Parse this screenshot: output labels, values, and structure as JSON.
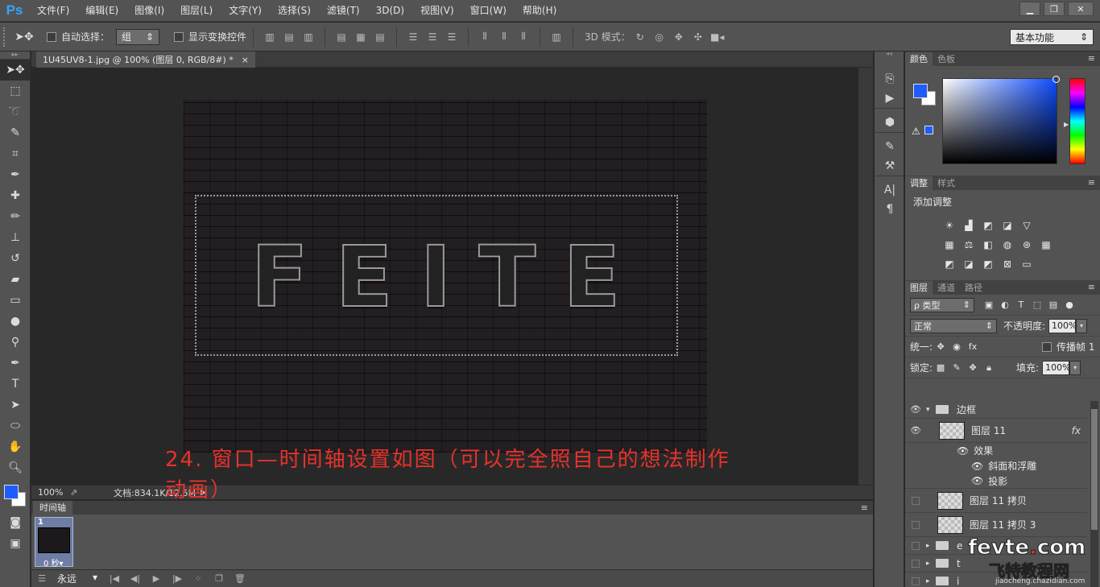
{
  "app": {
    "logo": "Ps"
  },
  "menu": [
    "文件(F)",
    "编辑(E)",
    "图像(I)",
    "图层(L)",
    "文字(Y)",
    "选择(S)",
    "滤镜(T)",
    "3D(D)",
    "视图(V)",
    "窗口(W)",
    "帮助(H)"
  ],
  "window_controls": {
    "minimize": "▁",
    "restore": "❐",
    "close": "✕"
  },
  "options": {
    "auto_select_label": "自动选择：",
    "auto_select_value": "组",
    "show_transform_label": "显示变换控件",
    "mode3d_label": "3D 模式：",
    "workspace": "基本功能"
  },
  "document": {
    "tab_title": "1U45UV8-1.jpg @ 100% (图层 0, RGB/8#) *",
    "close": "×",
    "art_text": "FEITE"
  },
  "status": {
    "zoom": "100%",
    "doc_info": "文档:834.1K/12.5M"
  },
  "timeline": {
    "tab": "时间轴",
    "frame_number": "1",
    "frame_delay": "0 秒▾",
    "loop": "永远"
  },
  "annotation": "24. 窗口—时间轴设置如图（可以完全照自己的想法制作动画）",
  "color_panel": {
    "tabs": [
      "颜色",
      "色板"
    ]
  },
  "adjust_panel": {
    "tabs": [
      "调整",
      "样式"
    ],
    "title": "添加调整"
  },
  "layers_panel": {
    "tabs": [
      "图层",
      "通道",
      "路径"
    ],
    "filter": "ρ 类型",
    "blend_mode": "正常",
    "opacity_label": "不透明度:",
    "opacity_value": "100%",
    "unify_label": "统一:",
    "propagate_label": "传播帧 1",
    "lock_label": "锁定:",
    "fill_label": "填充:",
    "fill_value": "100%",
    "layers": [
      {
        "name": "边框",
        "kind": "group",
        "visible": true,
        "expanded": true
      },
      {
        "name": "图层 11",
        "kind": "layer",
        "visible": true,
        "fx": "fx"
      },
      {
        "name": "效果",
        "kind": "effects"
      },
      {
        "name": "斜面和浮雕",
        "kind": "effect"
      },
      {
        "name": "投影",
        "kind": "effect"
      },
      {
        "name": "图层 11 拷贝",
        "kind": "layer",
        "visible": false
      },
      {
        "name": "图层 11 拷贝 3",
        "kind": "layer",
        "visible": false
      },
      {
        "name": "e",
        "kind": "group",
        "visible": false
      },
      {
        "name": "t",
        "kind": "group",
        "visible": false
      },
      {
        "name": "i",
        "kind": "group",
        "visible": false
      }
    ]
  },
  "watermark": {
    "main_a": "fevte",
    "main_dot": ".",
    "main_b": "com",
    "sub": "飞特教程网",
    "url": "jiaocheng.chazidian.com"
  },
  "colors": {
    "foreground": "#1f5cff",
    "background": "#ffffff",
    "annotation": "#e8312b"
  }
}
